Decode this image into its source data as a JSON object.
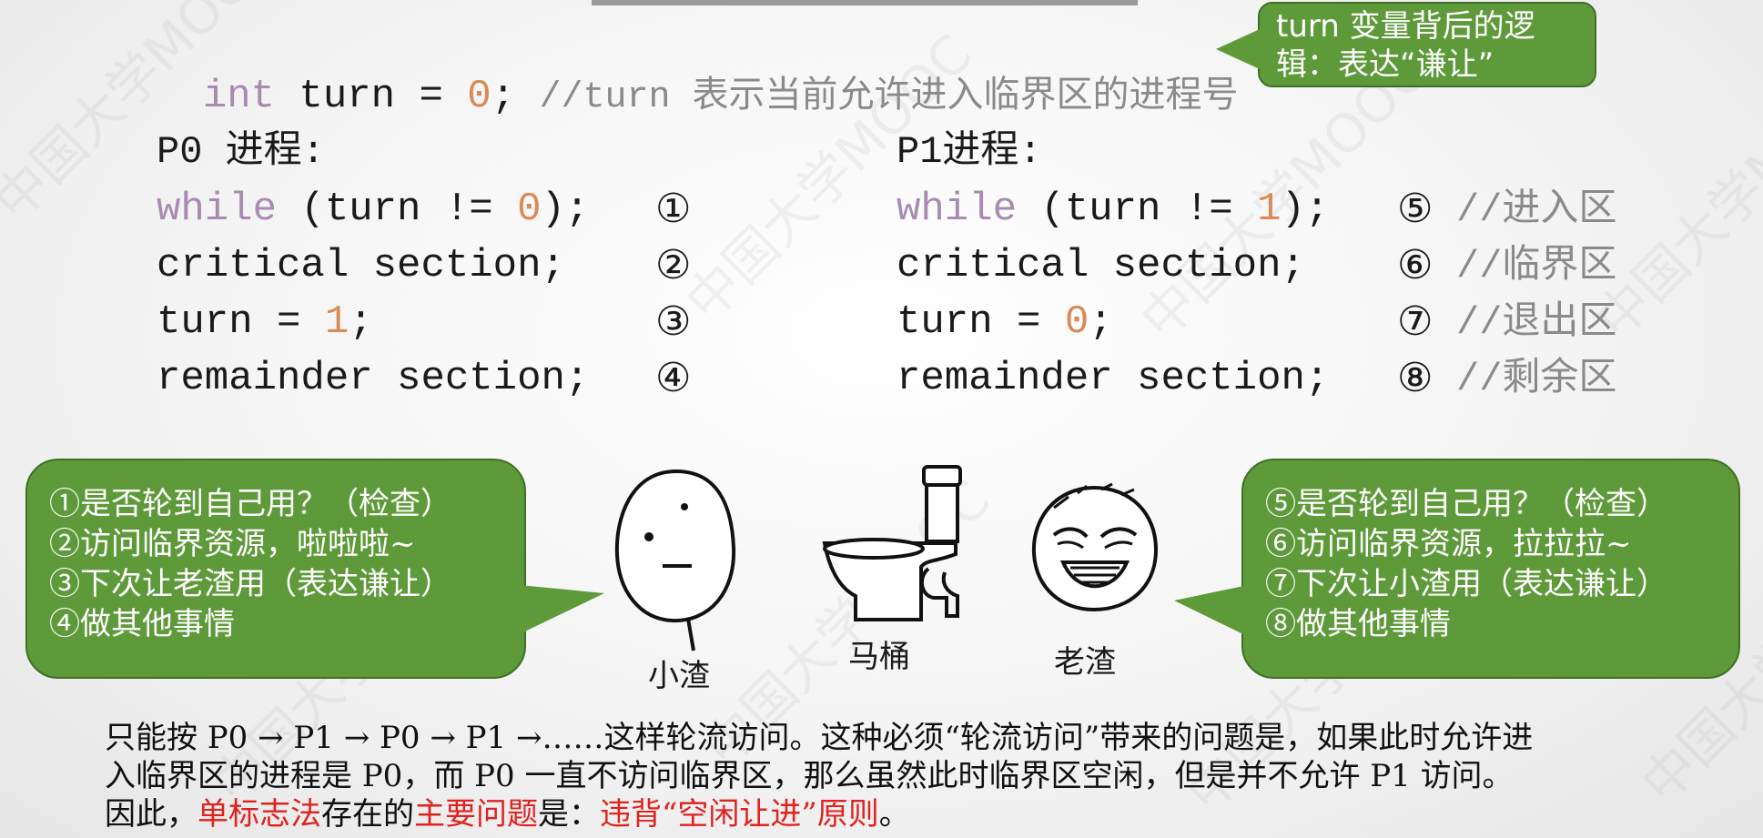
{
  "watermark": "中国大学MOOC",
  "top_code": {
    "kw": "int",
    "mid": " turn = ",
    "num": "0",
    "semi": "; ",
    "comment": "//turn 表示当前允许进入临界区的进程号"
  },
  "callout": {
    "line1": "turn 变量背后的逻",
    "line2": "辑：表达“谦让”"
  },
  "p0": {
    "title": "P0 进程:",
    "lines": [
      {
        "kw": "while",
        "a": " (turn != ",
        "num": "0",
        "b": ");",
        "marker": "①"
      },
      {
        "text": "critical section;",
        "marker": "②"
      },
      {
        "a": "turn = ",
        "num": "1",
        "b": ";",
        "marker": "③"
      },
      {
        "text": "remainder section;",
        "marker": "④"
      }
    ]
  },
  "p1": {
    "title": "P1进程:",
    "lines": [
      {
        "kw": "while",
        "a": " (turn != ",
        "num": "1",
        "b": ");",
        "marker": "⑤",
        "comment": "//进入区"
      },
      {
        "text": "critical section;",
        "marker": "⑥",
        "comment": "//临界区"
      },
      {
        "a": "turn = ",
        "num": "0",
        "b": ";",
        "marker": "⑦",
        "comment": "//退出区"
      },
      {
        "text": "remainder section;",
        "marker": "⑧",
        "comment": "//剩余区"
      }
    ]
  },
  "left_bubble": [
    "①是否轮到自己用？（检查）",
    "②访问临界资源，啦啦啦~",
    "③下次让老渣用（表达谦让）",
    "④做其他事情"
  ],
  "right_bubble": [
    "⑤是否轮到自己用？（检查）",
    "⑥访问临界资源，拉拉拉~",
    "⑦下次让小渣用（表达谦让）",
    "⑧做其他事情"
  ],
  "captions": {
    "left": "小渣",
    "middle": "马桶",
    "right": "老渣"
  },
  "bottom": {
    "line1": "只能按 P0 → P1 → P0 → P1 →……这样轮流访问。这种必须“轮流访问”带来的问题是，如果此时允许进",
    "line2": "入临界区的进程是 P0，而 P0 一直不访问临界区，那么虽然此时临界区空闲，但是并不允许 P1 访问。",
    "l3a": "因此，",
    "l3b": "单标志法",
    "l3c": "存在的",
    "l3d": "主要问题",
    "l3e": "是：",
    "l3f": "违背“空闲让进”原则",
    "l3g": "。"
  },
  "colors": {
    "bubble_green": "#5e9a3a",
    "keyword": "#a78bb0",
    "number": "#d98a55",
    "accent_red": "#e0221f"
  }
}
